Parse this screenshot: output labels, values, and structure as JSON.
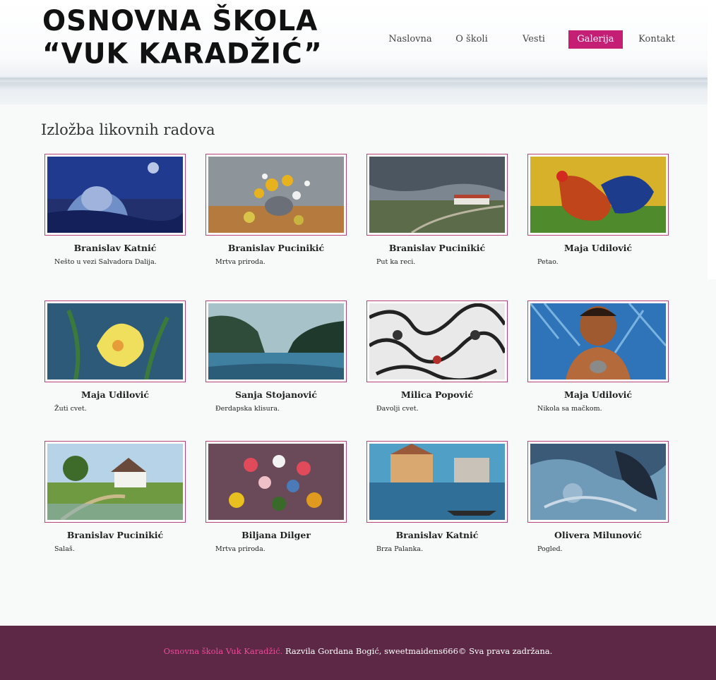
{
  "header": {
    "logo_line1": "OSNOVNA ŠKOLA",
    "logo_line2": "“VUK KARADŽIĆ”"
  },
  "nav": {
    "items": [
      {
        "label": "Naslovna",
        "active": false
      },
      {
        "label": "O školi",
        "active": false
      },
      {
        "label": "Vesti",
        "active": false
      },
      {
        "label": "Galerija",
        "active": true
      },
      {
        "label": "Kontakt",
        "active": false
      }
    ]
  },
  "gallery": {
    "title": "Izložba likovnih radova",
    "items": [
      {
        "artist": "Branislav Katnić",
        "caption": "Nešto u vezi Salvadora Dalija."
      },
      {
        "artist": "Branislav Pucinikić",
        "caption": "Mrtva priroda."
      },
      {
        "artist": "Branislav Pucinikić",
        "caption": "Put ka reci."
      },
      {
        "artist": "Maja Udilović",
        "caption": "Petao."
      },
      {
        "artist": "Maja Udilović",
        "caption": "Žuti cvet."
      },
      {
        "artist": "Sanja Stojanović",
        "caption": "Đerdapska klisura."
      },
      {
        "artist": "Milica Popović",
        "caption": "Đavolji cvet."
      },
      {
        "artist": "Maja Udilović",
        "caption": "Nikola sa mačkom."
      },
      {
        "artist": "Branislav Pucinikić",
        "caption": "Salaš."
      },
      {
        "artist": "Biljana Dilger",
        "caption": "Mrtva priroda."
      },
      {
        "artist": "Branislav Katnić",
        "caption": "Brza Palanka."
      },
      {
        "artist": "Olivera Milunović",
        "caption": "Pogled."
      }
    ]
  },
  "footer": {
    "brand": "Osnovna škola Vuk Karadžić.",
    "text": " Razvila Gordana Bogić, sweetmaidens666© Sva prava zadržana."
  },
  "colors": {
    "accent": "#c41f74",
    "footer_bg": "#5c2846",
    "footer_brand": "#f0489a",
    "thumb_border": "#b8427a"
  }
}
